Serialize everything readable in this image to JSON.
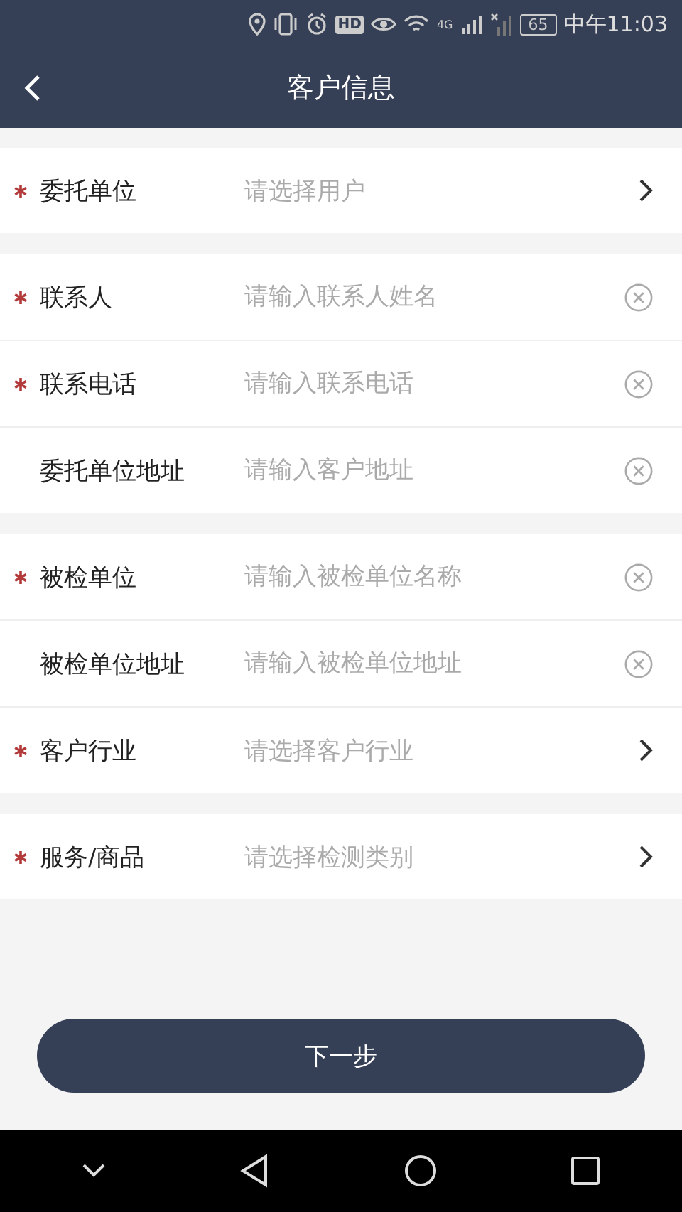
{
  "status_bar": {
    "hd": "HD",
    "network": "4G",
    "battery": "65",
    "time": "中午11:03"
  },
  "header": {
    "title": "客户信息"
  },
  "groups": [
    {
      "rows": [
        {
          "label": "委托单位",
          "placeholder": "请选择用户",
          "required": true,
          "kind": "select"
        }
      ]
    },
    {
      "rows": [
        {
          "label": "联系人",
          "placeholder": "请输入联系人姓名",
          "required": true,
          "kind": "input"
        },
        {
          "label": "联系电话",
          "placeholder": "请输入联系电话",
          "required": true,
          "kind": "input"
        },
        {
          "label": "委托单位地址",
          "placeholder": "请输入客户地址",
          "required": false,
          "kind": "input"
        }
      ]
    },
    {
      "rows": [
        {
          "label": "被检单位",
          "placeholder": "请输入被检单位名称",
          "required": true,
          "kind": "input"
        },
        {
          "label": "被检单位地址",
          "placeholder": "请输入被检单位地址",
          "required": false,
          "kind": "input"
        },
        {
          "label": "客户行业",
          "placeholder": "请选择客户行业",
          "required": true,
          "kind": "select"
        }
      ]
    },
    {
      "rows": [
        {
          "label": "服务/商品",
          "placeholder": "请选择检测类别",
          "required": true,
          "kind": "select"
        }
      ]
    }
  ],
  "next_button": "下一步"
}
